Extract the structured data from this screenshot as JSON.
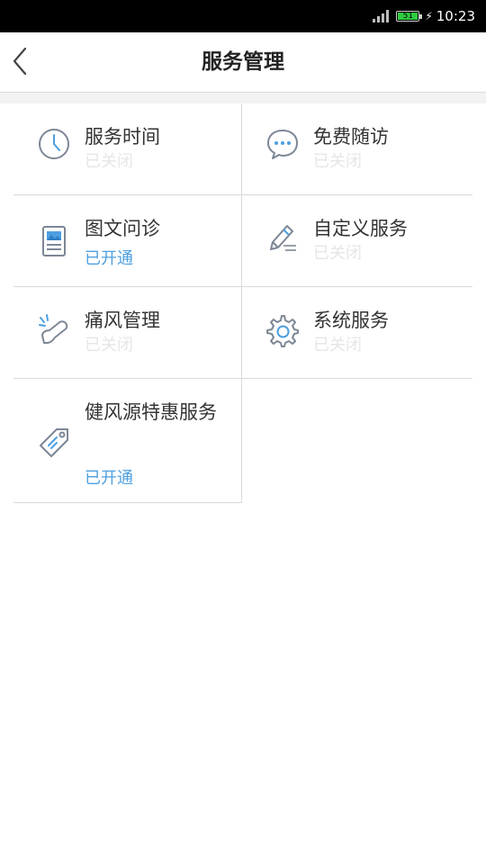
{
  "status_bar": {
    "battery": "51",
    "time": "10:23"
  },
  "header": {
    "title": "服务管理"
  },
  "services": [
    {
      "name": "服务时间",
      "status": "已关闭",
      "icon": "clock-icon"
    },
    {
      "name": "免费随访",
      "status": "已关闭",
      "icon": "chat-bubble-icon"
    },
    {
      "name": "图文问诊",
      "status": "已开通",
      "icon": "image-document-icon"
    },
    {
      "name": "自定义服务",
      "status": "已关闭",
      "icon": "pencil-edit-icon"
    },
    {
      "name": "痛风管理",
      "status": "已关闭",
      "icon": "foot-icon"
    },
    {
      "name": "系统服务",
      "status": "已关闭",
      "icon": "gear-icon"
    },
    {
      "name": "健风源特惠服务",
      "status": "已开通",
      "icon": "price-tag-icon"
    }
  ],
  "colors": {
    "enabled": "#4d9fe0",
    "disabled": "#e6e6e6",
    "icon": "#7d8795"
  }
}
